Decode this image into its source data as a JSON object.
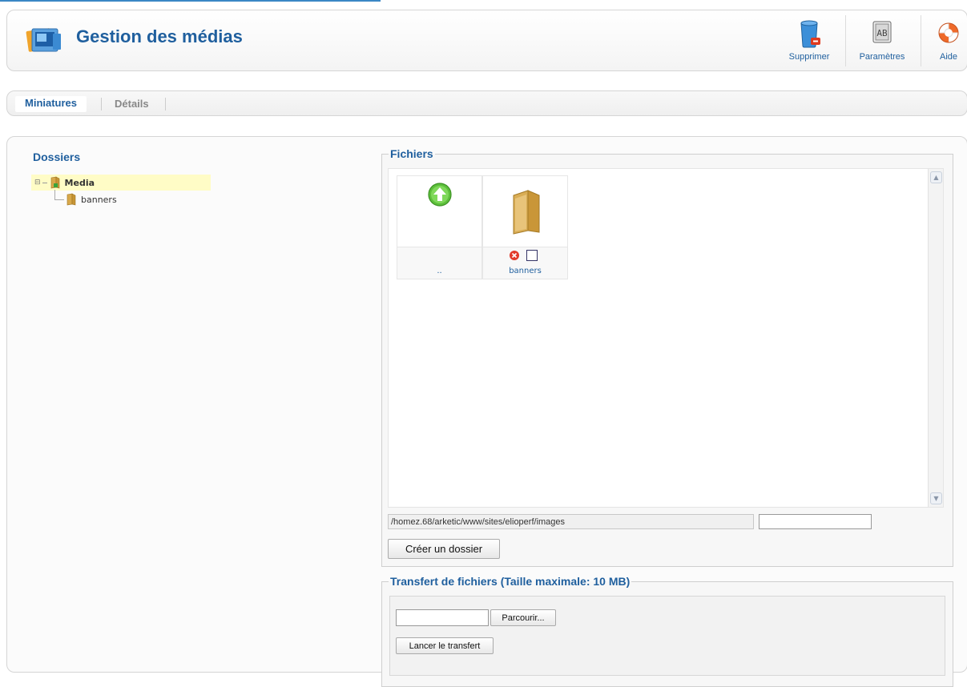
{
  "header": {
    "title": "Gestion des médias",
    "logo_icon": "media-manager-icon",
    "toolbar": [
      {
        "label": "Supprimer",
        "icon": "trash-icon"
      },
      {
        "label": "Paramètres",
        "icon": "parameters-icon"
      },
      {
        "label": "Aide",
        "icon": "help-lifebuoy-icon"
      }
    ]
  },
  "tabs": [
    {
      "label": "Miniatures",
      "active": true
    },
    {
      "label": "Détails",
      "active": false
    }
  ],
  "folders": {
    "title": "Dossiers",
    "tree": [
      {
        "label": "Media",
        "selected": true
      },
      {
        "label": "banners",
        "selected": false
      }
    ]
  },
  "files": {
    "legend": "Fichiers",
    "items": [
      {
        "label": "..",
        "icon": "folder-up-icon"
      },
      {
        "label": "banners",
        "icon": "folder-icon"
      }
    ],
    "path_value": "/homez.68/arketic/www/sites/elioperf/images",
    "folder_name_value": "",
    "create_folder_label": "Créer un dossier"
  },
  "upload": {
    "legend": "Transfert de fichiers (Taille maximale: 10 MB)",
    "browse_label": "Parcourir...",
    "file_value": "",
    "start_label": "Lancer le transfert"
  },
  "colors": {
    "accent": "#1f5f9e",
    "selection": "#fffcc6",
    "topline": "#3a87c5"
  }
}
